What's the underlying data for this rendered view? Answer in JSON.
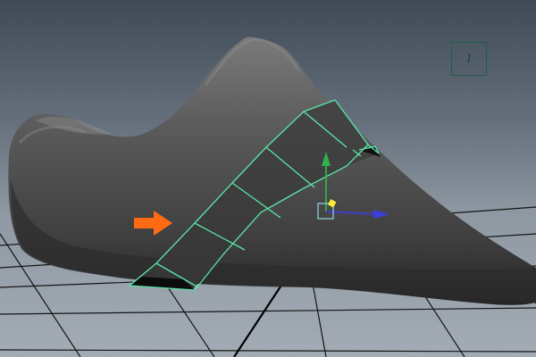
{
  "viewport": {
    "view_cube_label": "l"
  },
  "colors": {
    "selection_wire": "#59e6a8",
    "annotation_arrow": "#ff6a14",
    "manipulator_y_axis": "#2fb24a",
    "manipulator_x_axis": "#3a3fd8",
    "manipulator_pivot": "#ffe83a",
    "grid": "#141414"
  },
  "icons": {
    "annotation": "orange-arrow-right-icon",
    "manipulator": "move-manipulator-icon",
    "view_cube": "view-cube-icon"
  }
}
